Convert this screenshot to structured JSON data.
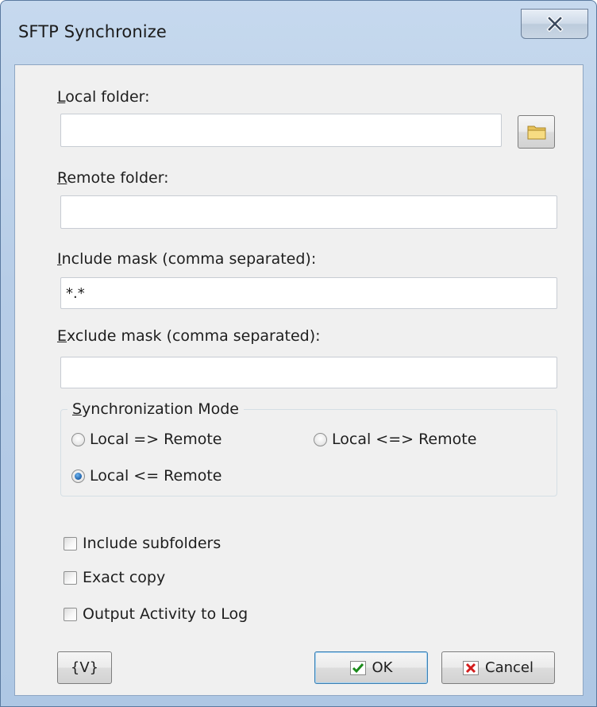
{
  "window": {
    "title": "SFTP Synchronize",
    "close_label": "x"
  },
  "local_folder": {
    "label_u": "L",
    "label_rest": "ocal folder:",
    "value": ""
  },
  "remote_folder": {
    "label_u": "R",
    "label_rest": "emote folder:",
    "value": ""
  },
  "include_mask": {
    "label_u": "I",
    "label_rest": "nclude mask (comma separated):",
    "value": "*.*"
  },
  "exclude_mask": {
    "label_u": "E",
    "label_rest": "xclude mask (comma separated):",
    "value": ""
  },
  "sync_mode": {
    "legend_u": "S",
    "legend_rest": "ynchronization Mode",
    "options": [
      {
        "label": "Local => Remote",
        "checked": false
      },
      {
        "label": "Local <=> Remote",
        "checked": false
      },
      {
        "label": "Local <= Remote",
        "checked": true
      }
    ]
  },
  "checkboxes": [
    {
      "label": "Include subfolders",
      "checked": false
    },
    {
      "label": "Exact copy",
      "checked": false
    },
    {
      "label": "Output Activity to Log",
      "checked": false
    }
  ],
  "buttons": {
    "variables": "{V}",
    "ok": "OK",
    "cancel": "Cancel"
  },
  "colors": {
    "ok_check": "#1a8a1a",
    "cancel_x": "#d21d1d",
    "radio_selected": "#1c5fa8"
  },
  "icons": {
    "browse": "folder-icon",
    "ok": "checkmark-icon",
    "cancel": "x-icon",
    "close": "close-icon"
  }
}
